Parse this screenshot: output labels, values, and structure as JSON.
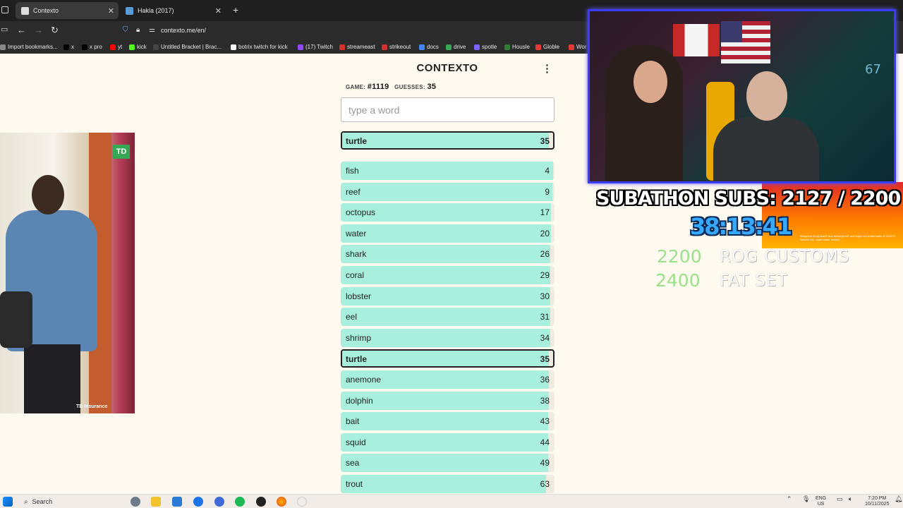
{
  "browser": {
    "tabs": [
      {
        "label": "Contexto",
        "active": true
      },
      {
        "label": "Hakla (2017)",
        "active": false
      }
    ],
    "new_tab": "+",
    "url": "contexto.me/en/",
    "bookmarks": [
      {
        "label": "Import bookmarks...",
        "color": "#888888"
      },
      {
        "label": "x",
        "color": "#000000"
      },
      {
        "label": "x pro",
        "color": "#000000"
      },
      {
        "label": "yt",
        "color": "#ff0000"
      },
      {
        "label": "kick",
        "color": "#53fc18"
      },
      {
        "label": "Untitled Bracket | Brac...",
        "color": "#444444"
      },
      {
        "label": "botrix twitch for kick",
        "color": "#ffffff"
      },
      {
        "label": "(17) Twitch",
        "color": "#9146ff"
      },
      {
        "label": "streameast",
        "color": "#d32f2f"
      },
      {
        "label": "strikeout",
        "color": "#d32f2f"
      },
      {
        "label": "docs",
        "color": "#4285f4"
      },
      {
        "label": "drive",
        "color": "#34a853"
      },
      {
        "label": "spotle",
        "color": "#7b61ff"
      },
      {
        "label": "Housle",
        "color": "#2e7d32"
      },
      {
        "label": "Globle",
        "color": "#e53935"
      },
      {
        "label": "Wor",
        "color": "#e53935"
      }
    ]
  },
  "game": {
    "title": "CONTEXTO",
    "menu": "⋮",
    "game_label": "GAME:",
    "game_number": "#1119",
    "guesses_label": "GUESSES:",
    "guesses_count": "35",
    "input_placeholder": "type a word",
    "last_guess": {
      "word": "turtle",
      "distance": 35,
      "fill": 0.98
    },
    "guesses": [
      {
        "word": "fish",
        "distance": 4,
        "fill": 0.995
      },
      {
        "word": "reef",
        "distance": 9,
        "fill": 0.99
      },
      {
        "word": "octopus",
        "distance": 17,
        "fill": 0.985
      },
      {
        "word": "water",
        "distance": 20,
        "fill": 0.985
      },
      {
        "word": "shark",
        "distance": 26,
        "fill": 0.98
      },
      {
        "word": "coral",
        "distance": 29,
        "fill": 0.98
      },
      {
        "word": "lobster",
        "distance": 30,
        "fill": 0.98
      },
      {
        "word": "eel",
        "distance": 31,
        "fill": 0.98
      },
      {
        "word": "shrimp",
        "distance": 34,
        "fill": 0.98
      },
      {
        "word": "turtle",
        "distance": 35,
        "fill": 0.98,
        "highlight": true
      },
      {
        "word": "anemone",
        "distance": 36,
        "fill": 0.975
      },
      {
        "word": "dolphin",
        "distance": 38,
        "fill": 0.975
      },
      {
        "word": "bait",
        "distance": 43,
        "fill": 0.97
      },
      {
        "word": "squid",
        "distance": 44,
        "fill": 0.97
      },
      {
        "word": "sea",
        "distance": 49,
        "fill": 0.97
      },
      {
        "word": "trout",
        "distance": 63,
        "fill": 0.96
      }
    ]
  },
  "ad": {
    "brand": "TD",
    "caption": "TD Insurance"
  },
  "overlay": {
    "subathon_text": "SUBATHON SUBS: 2127 / 2200",
    "timer": "38:13:41",
    "goals": [
      {
        "amount": "2200",
        "label": "ROG CUSTOMS"
      },
      {
        "amount": "2400",
        "label": "FAT SET"
      }
    ],
    "cam_number": "67",
    "banner_fine_print": "Shoppers Drug Mart® and Beautyprix® and logos are trademarks of 911979 Alberta Ltd., used under license."
  },
  "taskbar": {
    "search_label": "Search",
    "lang_top": "ENG",
    "lang_bottom": "US",
    "time": "7:20 PM",
    "date": "10/11/2025"
  }
}
